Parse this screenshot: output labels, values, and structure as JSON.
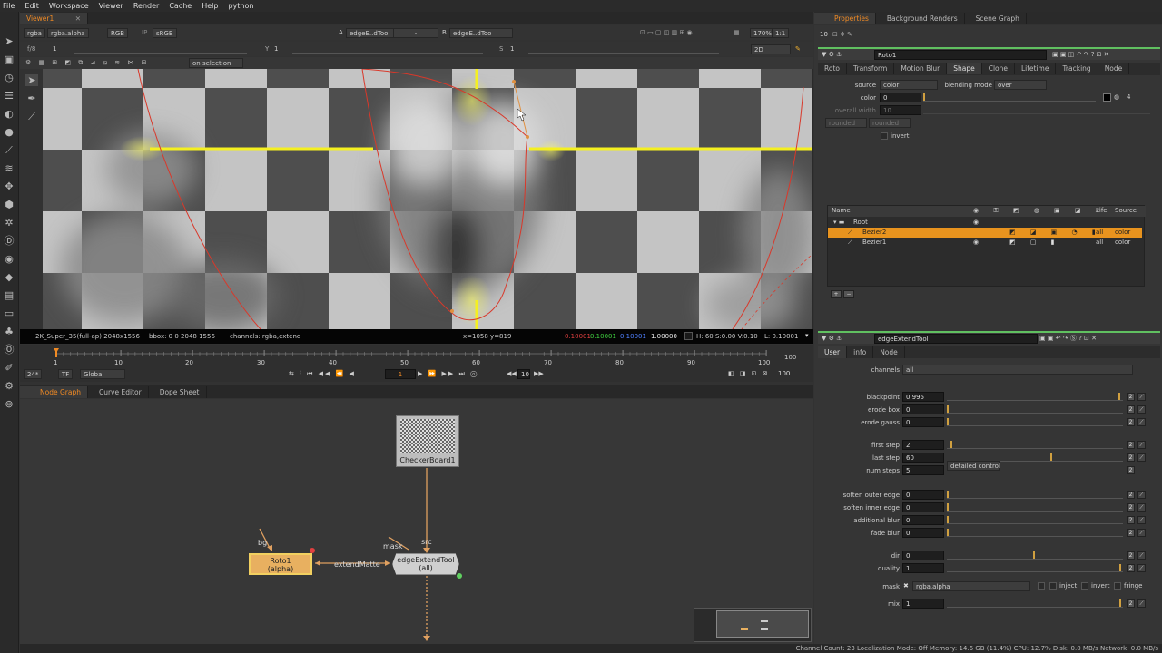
{
  "menu": [
    "File",
    "Edit",
    "Workspace",
    "Viewer",
    "Render",
    "Cache",
    "Help",
    "python"
  ],
  "viewer": {
    "tab": "Viewer1",
    "row1": {
      "channels": "rgba",
      "alpha": "rgba.alpha",
      "mode": "RGB",
      "ip": "IP",
      "lut": "sRGB",
      "a_label": "A",
      "a_input": "edgeE..dToo",
      "dash": "-",
      "b_label": "B",
      "b_input": "edgeE..dToo",
      "zoom": "170%",
      "ratio": "1:1",
      "view": "2D"
    },
    "row2": {
      "fstop": "f/8",
      "fstop_val": "1",
      "y_label": "Y",
      "y_val": "1",
      "s_label": "S",
      "s_val": "1"
    },
    "row3": {
      "on_selection": "on selection"
    },
    "info_bar": {
      "format": "2K_Super_35(full-ap) 2048x1556",
      "bbox": "bbox: 0 0 2048 1556",
      "channels": "channels: rgba,extend",
      "xy": "x=1058 y=819",
      "r": "0.10001",
      "g": "0.10001",
      "b": "0.10001",
      "a": "1.00000",
      "hsv": "H: 60 S:0.00 V:0.10",
      "l": "L: 0.10001"
    }
  },
  "timeline": {
    "ticks": [
      "1",
      "10",
      "20",
      "30",
      "40",
      "50",
      "60",
      "70",
      "80",
      "90",
      "100"
    ],
    "end": "100",
    "fps": "24*",
    "tf": "TF",
    "global": "Global",
    "frame": "1",
    "step": "10",
    "out": "100"
  },
  "nodegraph": {
    "tabs": [
      "Node Graph",
      "Curve Editor",
      "Dope Sheet"
    ],
    "checker": "CheckerBoard1",
    "roto_name": "Roto1",
    "roto_sub": "(alpha)",
    "edge_name": "edgeExtendTool",
    "edge_sub": "(all)",
    "bg_label": "bg",
    "mask_label": "mask",
    "src_label": "src",
    "extend_label": "extendMatte"
  },
  "properties": {
    "tabs": [
      "Properties",
      "Background Renders",
      "Scene Graph"
    ],
    "count": "10",
    "roto": {
      "name": "Roto1",
      "tabs": [
        "Roto",
        "Transform",
        "Motion Blur",
        "Shape",
        "Clone",
        "Lifetime",
        "Tracking",
        "Node"
      ],
      "source_label": "source",
      "source": "color",
      "blend_label": "blending mode",
      "blend": "over",
      "color_label": "color",
      "color_val": "0",
      "width_label": "overall width",
      "width_val": "10",
      "rounded1": "rounded",
      "rounded2": "rounded",
      "invert": "invert",
      "alpha_ch": "4",
      "color_ticks": [
        "0",
        "0.05",
        "0.1",
        "0.2",
        "0.3",
        "0.4",
        "0.5",
        "0.6",
        "0.7",
        "0.8",
        "0.9",
        "1"
      ],
      "width_ticks": [
        "0",
        "10",
        "20",
        "30",
        "40",
        "50",
        "60",
        "70",
        "80",
        "90",
        "100"
      ],
      "tree_headers": {
        "name": "Name",
        "life": "Life",
        "source": "Source"
      },
      "tree": [
        {
          "name": "Root"
        },
        {
          "name": "Bezier2",
          "life": "all",
          "source": "color"
        },
        {
          "name": "Bezier1",
          "life": "all",
          "source": "color"
        }
      ],
      "add": "+",
      "remove": "−"
    },
    "edge": {
      "name": "edgeExtendTool",
      "tabs": [
        "User",
        "info",
        "Node"
      ],
      "channels_label": "channels",
      "channels": "all",
      "params": [
        {
          "label": "blackpoint",
          "value": "0.995"
        },
        {
          "label": "erode box",
          "value": "0"
        },
        {
          "label": "erode gauss",
          "value": "0"
        },
        {
          "label": "first step",
          "value": "2"
        },
        {
          "label": "last step",
          "value": "60"
        },
        {
          "label": "num steps",
          "value": "5"
        },
        {
          "label": "soften outer edge",
          "value": "0"
        },
        {
          "label": "soften inner edge",
          "value": "0"
        },
        {
          "label": "additional blur",
          "value": "0"
        },
        {
          "label": "fade blur",
          "value": "0"
        },
        {
          "label": "dir",
          "value": "0"
        },
        {
          "label": "quality",
          "value": "1"
        },
        {
          "label": "mix",
          "value": "1"
        }
      ],
      "detailed": "detailed control",
      "num_steps_val": "2",
      "mask_label": "mask",
      "mask_val": "rgba.alpha",
      "inject": "inject",
      "invert": "invert",
      "fringe": "fringe",
      "step_ticks": [
        "0",
        "10",
        "20",
        "30",
        "40",
        "50",
        "60",
        "70",
        "80",
        "90",
        "100"
      ],
      "dir_ticks": [
        "-180",
        "-90",
        "0",
        "90",
        "180"
      ],
      "bp_ticks": [
        "0",
        "0.1",
        "0.2",
        "0.3",
        "0.4",
        "0.5",
        "0.6",
        "0.7",
        "0.8",
        "0.9",
        "1"
      ]
    }
  },
  "status": "Channel Count: 23  Localization Mode: Off  Memory: 14.6 GB (11.4%)  CPU: 12.7%  Disk: 0.0 MB/s  Network: 0.0 MB/s",
  "colors": {
    "accent": "#f08a24",
    "selection": "#e8931e",
    "highlight": "#ffff30",
    "curve": "#e03a2a"
  }
}
